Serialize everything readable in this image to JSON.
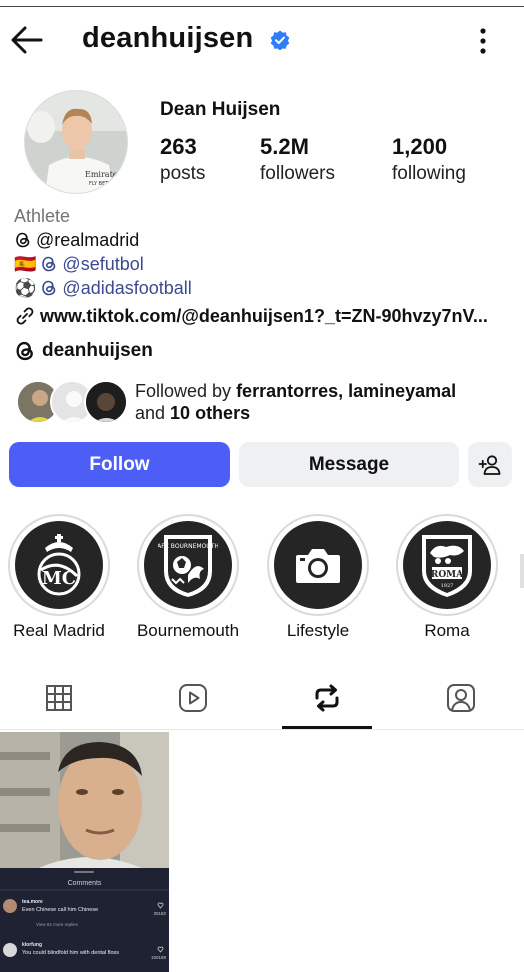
{
  "header": {
    "username": "deanhuijsen",
    "back_icon": "arrow-left-icon",
    "verified_icon": "verified-badge-icon",
    "more_icon": "more-vertical-icon"
  },
  "profile": {
    "full_name": "Dean Huijsen",
    "stats": [
      {
        "value": "263",
        "label": "posts"
      },
      {
        "value": "5.2M",
        "label": "followers"
      },
      {
        "value": "1,200",
        "label": "following"
      }
    ],
    "category": "Athlete",
    "bio_lines": [
      {
        "prefix": "",
        "text": "@realmadrid",
        "is_link": false
      },
      {
        "prefix": "🇪🇸",
        "text": "@sefutbol",
        "is_link": true
      },
      {
        "prefix": "⚽",
        "text": "@adidasfootball",
        "is_link": true
      }
    ],
    "website": "www.tiktok.com/@deanhuijsen1?_t=ZN-90hvzy7nV...",
    "threads_handle": "deanhuijsen",
    "followed_by": {
      "prefix": "Followed by ",
      "names": "ferrantorres, lamineyamal",
      "and_text": "and ",
      "others": "10 others"
    }
  },
  "buttons": {
    "follow": "Follow",
    "message": "Message",
    "add_person_icon": "add-person-icon"
  },
  "highlights": [
    {
      "name": "Real Madrid",
      "icon": "real-madrid-crest-icon"
    },
    {
      "name": "Bournemouth",
      "icon": "bournemouth-crest-icon"
    },
    {
      "name": "Lifestyle",
      "icon": "camera-icon"
    },
    {
      "name": "Roma",
      "icon": "roma-crest-icon"
    }
  ],
  "tabs": [
    {
      "icon": "grid-icon",
      "active": false
    },
    {
      "icon": "reels-icon",
      "active": false
    },
    {
      "icon": "reposts-icon",
      "active": true
    },
    {
      "icon": "tagged-icon",
      "active": false
    }
  ],
  "post": {
    "comments_title": "Comments",
    "comment1_user": "tea.more",
    "comment1_text": "Even Chinese call him Chinese",
    "comment1_replies": "View 82 more replies",
    "comment1_likes": "30182",
    "comment2_user": "klorfung",
    "comment2_text": "You could blindfold him with dental floss",
    "comment2_likes": "150189"
  },
  "colors": {
    "follow_button": "#4d5ef7",
    "secondary_button": "#eff0f2",
    "link": "#3b4a8f",
    "verified": "#2f7ef7"
  }
}
